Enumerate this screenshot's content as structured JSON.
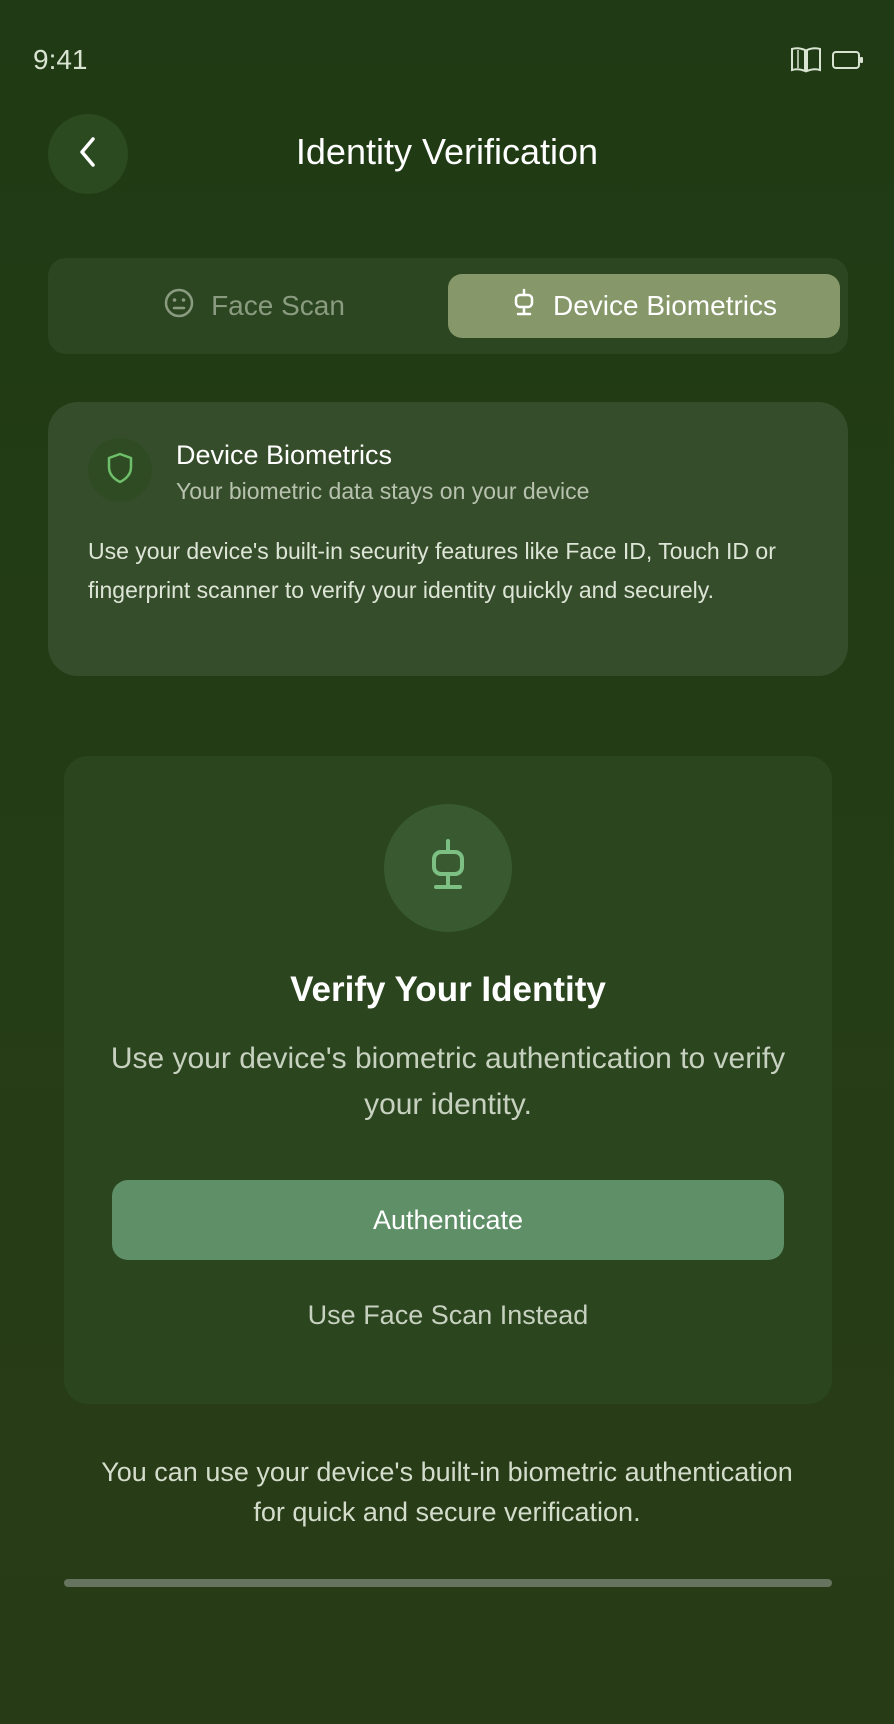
{
  "status_bar": {
    "time": "9:41",
    "icons": [
      "book-icon",
      "battery-icon"
    ]
  },
  "header": {
    "title": "Identity Verification",
    "back_icon": "chevron-left-icon"
  },
  "tabs": [
    {
      "label": "Face Scan",
      "icon": "face-icon",
      "selected": false
    },
    {
      "label": "Device Biometrics",
      "icon": "fingerprint-sensor-icon",
      "selected": true
    }
  ],
  "info_card": {
    "icon": "shield-icon",
    "title": "Device Biometrics",
    "subtitle": "Your biometric data stays on your device",
    "description": "Use your device's built-in security features like Face ID, Touch ID or fingerprint scanner to verify your identity quickly and securely."
  },
  "verify_card": {
    "icon": "fingerprint-sensor-icon",
    "title": "Verify Your Identity",
    "subtitle": "Use your device's biometric authentication to verify your identity.",
    "primary_button": "Authenticate",
    "secondary_link": "Use Face Scan Instead"
  },
  "footer": {
    "note": "You can use your device's built-in biometric authentication for quick and secure verification."
  },
  "colors": {
    "background": "#253d17",
    "accent": "#5e8f67",
    "selected_tab": "#86986a",
    "icon_green": "#7cc083"
  }
}
